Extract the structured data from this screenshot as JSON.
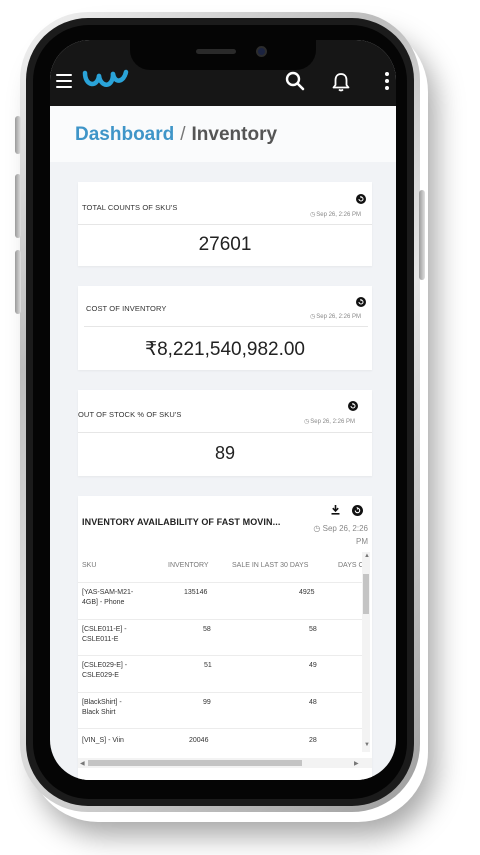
{
  "header": {
    "icons": [
      "menu-icon",
      "logo",
      "search-icon",
      "bell-icon",
      "more-vertical-icon"
    ]
  },
  "breadcrumb": {
    "parent": "Dashboard",
    "separator": "/",
    "current": "Inventory"
  },
  "cards": [
    {
      "title": "TOTAL COUNTS OF SKU'S",
      "timestamp": "Sep 26, 2:26 PM",
      "value": "27601"
    },
    {
      "title": "COST OF INVENTORY",
      "timestamp": "Sep 26, 2:26 PM",
      "value": "₹8,221,540,982.00"
    },
    {
      "title": "OUT OF STOCK % OF SKU'S",
      "timestamp": "Sep 26, 2:26 PM",
      "value": "89"
    }
  ],
  "inventory": {
    "title": "INVENTORY AVAILABILITY OF FAST MOVIN...",
    "timestamp_line1": "Sep 26, 2:26",
    "timestamp_line2": "PM",
    "columns": [
      "SKU",
      "INVENTORY",
      "SALE IN LAST 30 DAYS",
      "DAYS C"
    ],
    "rows": [
      {
        "sku_line1": "[YAS-SAM-M21-",
        "sku_line2": "4GB] - Phone",
        "inventory": "135146",
        "sale": "4925"
      },
      {
        "sku_line1": "[CSLE011-E] -",
        "sku_line2": "CSLE011-E",
        "inventory": "58",
        "sale": "58"
      },
      {
        "sku_line1": "[CSLE029-E] -",
        "sku_line2": "CSLE029-E",
        "inventory": "51",
        "sale": "49"
      },
      {
        "sku_line1": "[BlackShirt] -",
        "sku_line2": "Black Shirt",
        "inventory": "99",
        "sale": "48"
      },
      {
        "sku_line1": "[VIN_S] - Viin",
        "sku_line2": "",
        "inventory": "20046",
        "sale": "28"
      }
    ]
  },
  "colors": {
    "appbar": "#161616",
    "accent": "#3f95c8",
    "logo": "#2aa3d8"
  }
}
